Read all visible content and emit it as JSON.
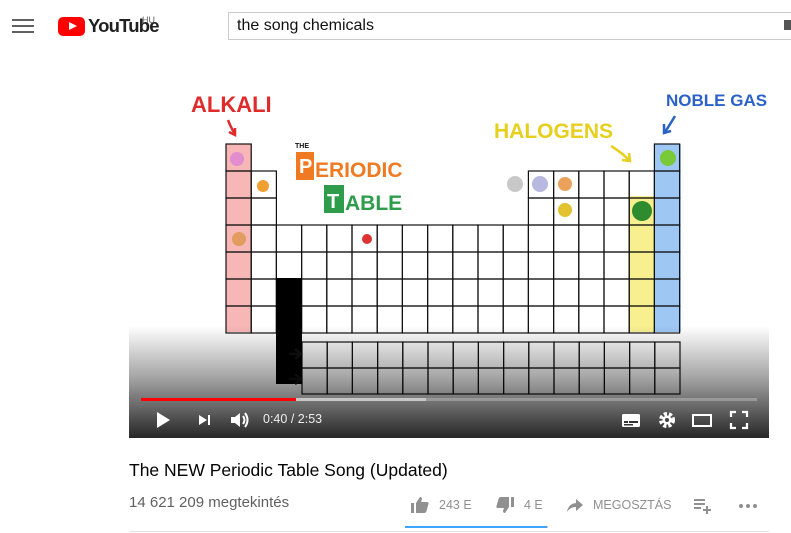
{
  "header": {
    "logo_text": "YouTube",
    "country_code": "HU",
    "search_value": "the song chemicals"
  },
  "video": {
    "frame_labels": {
      "alkali": "ALKALI",
      "halogens": "HALOGENS",
      "noble_gas": "NOBLE GAS",
      "periodic": "ERIODIC",
      "table": "ABLE",
      "the": "THE"
    },
    "progress_fraction": 0.2516,
    "current_time": "0:40",
    "duration": "2:53",
    "time_separator": " / "
  },
  "info": {
    "title": "The NEW Periodic Table Song (Updated)",
    "views": "14 621 209 megtekintés",
    "likes": "243 E",
    "dislikes": "4 E",
    "share_label": "MEGOSZTÁS"
  },
  "colors": {
    "brand": "#ff0000",
    "progress": "#ff0000",
    "sentiment": "#3ea6ff",
    "alkali": "#e83535",
    "halogens": "#f0e040",
    "noble": "#3d8fe0"
  }
}
